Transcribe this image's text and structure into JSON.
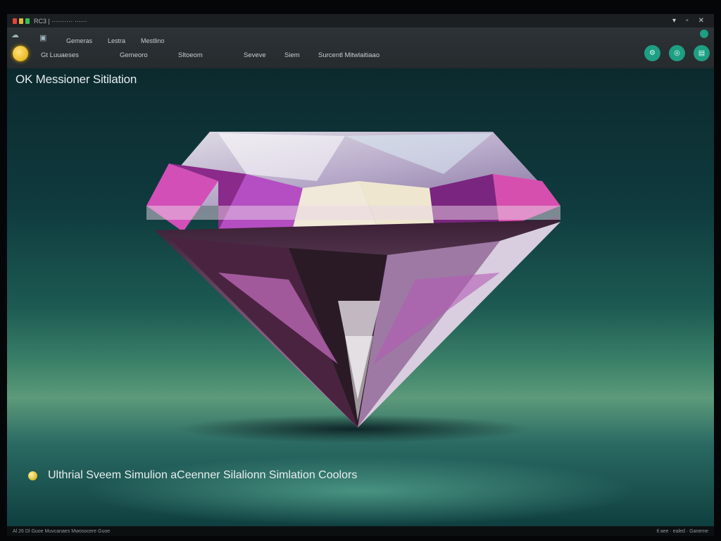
{
  "window": {
    "title": "RC3 | ·········· ······",
    "controls": [
      "▾",
      "▫",
      "✕"
    ]
  },
  "toolbar": {
    "menu_top": [
      "Gemeras",
      "Lestra",
      "Mestlino"
    ],
    "menu_bottom": [
      "Gt Luuaeses",
      "Gemeoro",
      "Sltoeom",
      "Seveve",
      "Siem",
      "Surcentl Mitwlaitiaao"
    ],
    "right_buttons": [
      "⚙",
      "◎",
      "▤"
    ]
  },
  "main": {
    "title": "OK Messioner Sitilation",
    "caption": "Ulthrial Sveem Simulion aCeenner Silalionn Simlation Coolors"
  },
  "status": {
    "left": "Al 26 Dl Guoe Muvcanaes Mwosocere Guoe",
    "right": "tl aee · ealed · Ganeme"
  },
  "colors": {
    "accent_teal": "#1e9e82",
    "accent_yellow": "#e0a800",
    "gem_pink": "#d24fb8"
  },
  "icons": {
    "app": "app-grid-icon",
    "settings_button": "gear-icon",
    "view_button": "target-icon",
    "panel_button": "panel-icon"
  }
}
